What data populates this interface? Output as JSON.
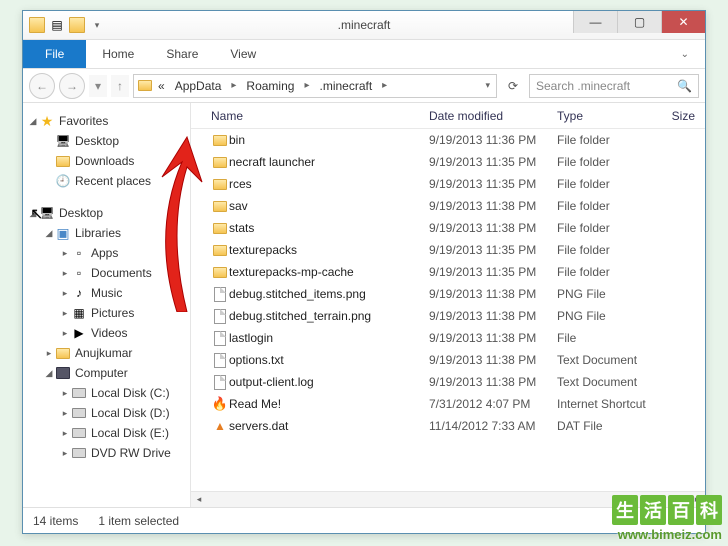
{
  "window": {
    "title": ".minecraft"
  },
  "ribbon": {
    "file": "File",
    "home": "Home",
    "share": "Share",
    "view": "View"
  },
  "breadcrumbs": {
    "b0": "«",
    "b1": "AppData",
    "b2": "Roaming",
    "b3": ".minecraft"
  },
  "search": {
    "placeholder": "Search .minecraft"
  },
  "columns": {
    "name": "Name",
    "date": "Date modified",
    "type": "Type",
    "size": "Size"
  },
  "sidebar": {
    "favorites": "Favorites",
    "desktop": "Desktop",
    "downloads": "Downloads",
    "recent": "Recent places",
    "desktop2": "Desktop",
    "libraries": "Libraries",
    "apps": "Apps",
    "documents": "Documents",
    "music": "Music",
    "pictures": "Pictures",
    "videos": "Videos",
    "user": "Anujkumar",
    "computer": "Computer",
    "diskc": "Local Disk (C:)",
    "diskd": "Local Disk (D:)",
    "diske": "Local Disk (E:)",
    "dvd": "DVD RW Drive"
  },
  "files": [
    {
      "name": "bin",
      "date": "9/19/2013 11:36 PM",
      "type": "File folder",
      "icon": "folder"
    },
    {
      "name": "necraft launcher",
      "date": "9/19/2013 11:35 PM",
      "type": "File folder",
      "icon": "folder"
    },
    {
      "name": "rces",
      "date": "9/19/2013 11:35 PM",
      "type": "File folder",
      "icon": "folder"
    },
    {
      "name": "sav",
      "date": "9/19/2013 11:38 PM",
      "type": "File folder",
      "icon": "folder"
    },
    {
      "name": "stats",
      "date": "9/19/2013 11:38 PM",
      "type": "File folder",
      "icon": "folder"
    },
    {
      "name": "texturepacks",
      "date": "9/19/2013 11:35 PM",
      "type": "File folder",
      "icon": "folder"
    },
    {
      "name": "texturepacks-mp-cache",
      "date": "9/19/2013 11:35 PM",
      "type": "File folder",
      "icon": "folder"
    },
    {
      "name": "debug.stitched_items.png",
      "date": "9/19/2013 11:38 PM",
      "type": "PNG File",
      "icon": "file"
    },
    {
      "name": "debug.stitched_terrain.png",
      "date": "9/19/2013 11:38 PM",
      "type": "PNG File",
      "icon": "file"
    },
    {
      "name": "lastlogin",
      "date": "9/19/2013 11:38 PM",
      "type": "File",
      "icon": "file"
    },
    {
      "name": "options.txt",
      "date": "9/19/2013 11:38 PM",
      "type": "Text Document",
      "icon": "file"
    },
    {
      "name": "output-client.log",
      "date": "9/19/2013 11:38 PM",
      "type": "Text Document",
      "icon": "file"
    },
    {
      "name": "Read Me!",
      "date": "7/31/2012 4:07 PM",
      "type": "Internet Shortcut",
      "icon": "net"
    },
    {
      "name": "servers.dat",
      "date": "11/14/2012 7:33 AM",
      "type": "DAT File",
      "icon": "vlc"
    }
  ],
  "status": {
    "count": "14 items",
    "selected": "1 item selected"
  },
  "watermark": {
    "chars": [
      "生",
      "活",
      "百",
      "科"
    ],
    "url": "www.bimeiz.com"
  }
}
